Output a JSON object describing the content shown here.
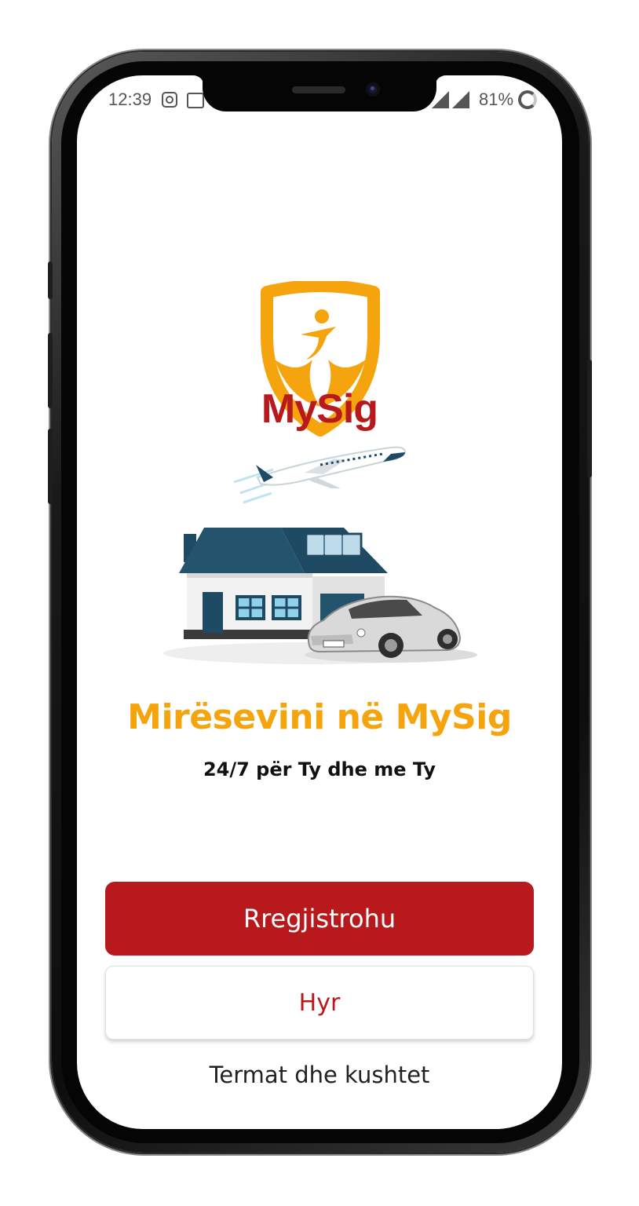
{
  "status_bar": {
    "time": "12:39",
    "battery": "81%",
    "icons": [
      "instagram-icon",
      "image-notification-icon",
      "signal-icon",
      "signal-icon",
      "battery-saver-icon"
    ]
  },
  "brand": {
    "name": "MySig",
    "primary_color": "#b8191c",
    "accent_color": "#f6a40e"
  },
  "welcome": {
    "title": "Mirësevini në MySig",
    "subtitle": "24/7 për Ty dhe me Ty"
  },
  "actions": {
    "register_label": "Rregjistrohu",
    "login_label": "Hyr",
    "terms_label": "Termat dhe kushtet"
  }
}
